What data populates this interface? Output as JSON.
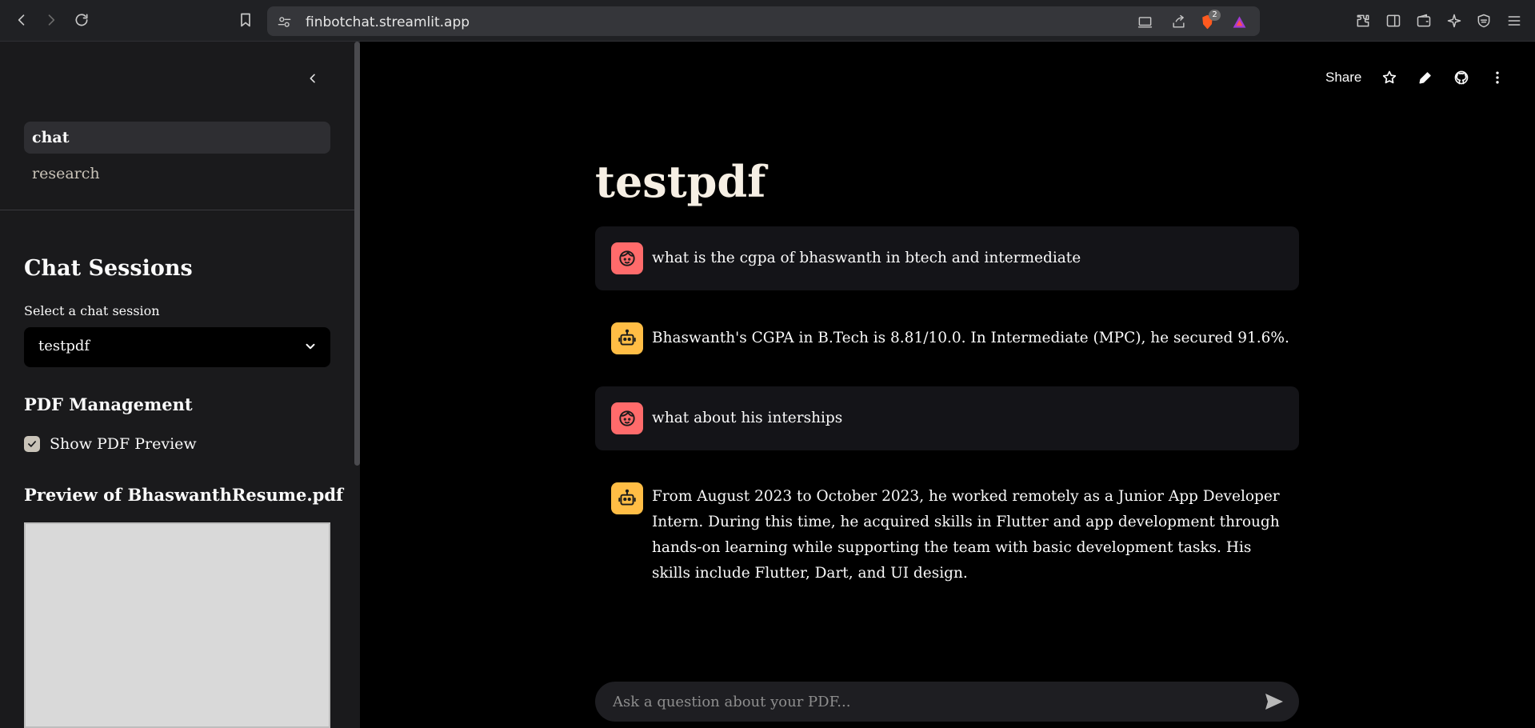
{
  "browser": {
    "url": "finbotchat.streamlit.app",
    "extension_badge": "2"
  },
  "sidebar": {
    "nav": [
      {
        "label": "chat",
        "active": true
      },
      {
        "label": "research",
        "active": false
      }
    ],
    "chat_sessions_heading": "Chat Sessions",
    "select_label": "Select a chat session",
    "selected_session": "testpdf",
    "pdf_management_heading": "PDF Management",
    "show_preview_label": "Show PDF Preview",
    "show_preview_checked": true,
    "preview_heading": "Preview of BhaswanthResume.pdf"
  },
  "toolbar": {
    "share_label": "Share"
  },
  "main": {
    "title": "testpdf",
    "messages": [
      {
        "role": "user",
        "text": "what is the cgpa of bhaswanth in btech and intermediate"
      },
      {
        "role": "assistant",
        "text": "Bhaswanth's CGPA in B.Tech is 8.81/10.0. In Intermediate (MPC), he secured 91.6%."
      },
      {
        "role": "user",
        "text": "what about his interships"
      },
      {
        "role": "assistant",
        "text": "From August 2023 to October 2023, he worked remotely as a Junior App Developer Intern. During this time, he acquired skills in Flutter and app development through hands-on learning while supporting the team with basic development tasks. His skills include Flutter, Dart, and UI design."
      }
    ],
    "input_placeholder": "Ask a question about your PDF..."
  },
  "colors": {
    "user_avatar": "#ff6b6b",
    "bot_avatar": "#ffbd45",
    "sidebar_bg": "#1a1a1c",
    "main_bg": "#000000"
  }
}
